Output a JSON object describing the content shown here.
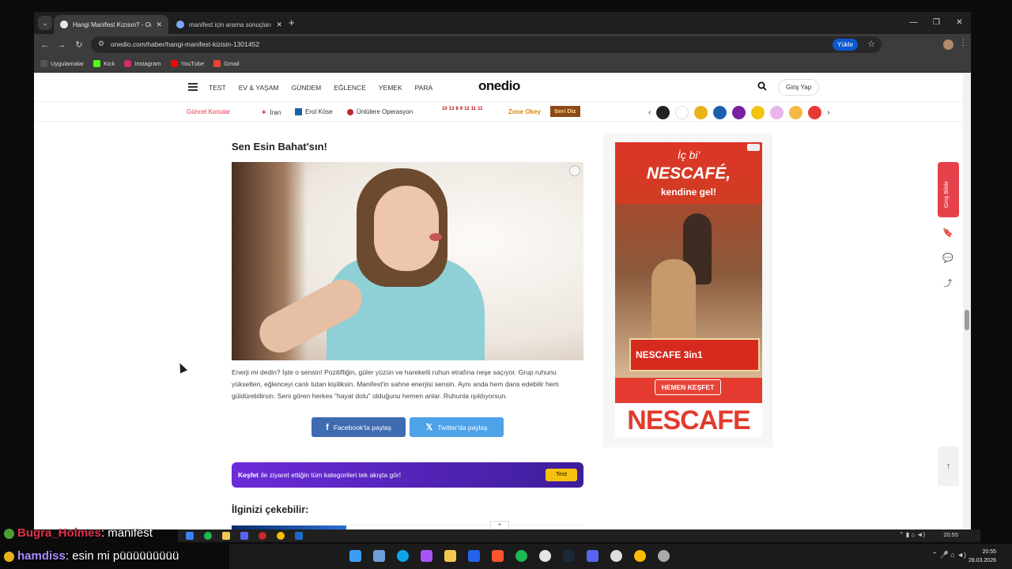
{
  "browser": {
    "tabs": [
      {
        "title": "Hangi Manifest Kızısın? - Oned",
        "active": true
      },
      {
        "title": "manifest için arama sonuçları -",
        "active": false
      }
    ],
    "url": "onedio.com/haber/hangi-manifest-kizisin-1301452",
    "install_label": "Yükle",
    "bookmarks": [
      "Uygulamalar",
      "Kick",
      "Instagram",
      "YouTube",
      "Gmail"
    ]
  },
  "site": {
    "nav": [
      "TEST",
      "EV & YAŞAM",
      "GÜNDEM",
      "EĞLENCE",
      "YEMEK",
      "PARA"
    ],
    "logo": "onedio",
    "login": "Giriş Yap",
    "trending_label": "Güncel Konular",
    "trending": [
      "İran",
      "Erol Köse",
      "Ünlülere Operasyon"
    ],
    "game_numbers": [
      "10",
      "13",
      "8",
      "9",
      "12",
      "11",
      "11"
    ],
    "zone": "Zone Okey",
    "seri": "Seri Diz"
  },
  "result": {
    "title": "Sen Esin Bahat'sın!",
    "description": "Enerji mi dedin? İşte o sensin! Pozitifliğin, güler yüzün ve hareketli ruhun etrafına neşe saçıyor. Grup ruhunu yükselten, eğlenceyi canlı tutan kişiliksin. Manifest'in sahne enerjisi sensin. Aynı anda hem dans edebilir hem güldürebilirsin. Seni gören herkes \"hayat dolu\" olduğunu hemen anlar. Ruhunla ışıldıyorsun.",
    "share_facebook": "Facebook'ta paylaş",
    "share_twitter": "Twitter'da paylaş"
  },
  "kesfet": {
    "bold": "Keşfet",
    "text": "ile ziyaret ettiğin tüm kategorileri tek akışta gör!",
    "button": "Test"
  },
  "related_heading": "İlginizi çekebilir:",
  "ad": {
    "line1": "İç bi'",
    "line2": "NESCAFÉ,",
    "line3": "kendine gel!",
    "pack": "NESCAFE 3in1",
    "cta": "HEMEN KEŞFET",
    "brand": "NESCAFE"
  },
  "side": {
    "login_vertical": "Giriş Bildir"
  },
  "chat": {
    "user1": "Bugra_Holmes",
    "msg1": ": manifest",
    "user2": "hamdiss",
    "msg2": ": esin mi püüüüüüüüü"
  },
  "system": {
    "time_small": "20:55",
    "clock_time": "20:55",
    "clock_date": "28.03.2026"
  }
}
